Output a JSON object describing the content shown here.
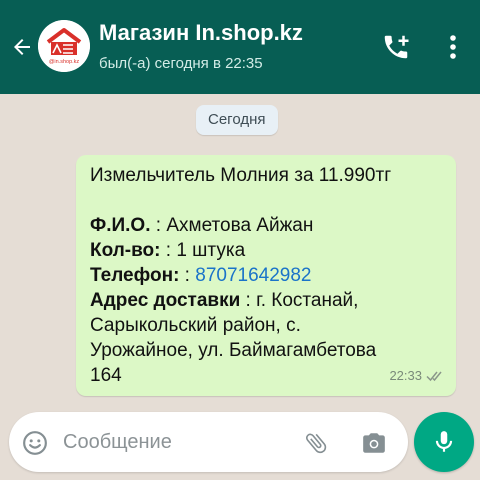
{
  "header": {
    "contact_name": "Магазин In.shop.kz",
    "last_seen": "был(-а) сегодня в 22:35",
    "avatar_text": "@in.shop.kz",
    "icons": {
      "back": "arrow-left-icon",
      "call": "add-call-icon",
      "menu": "more-vertical-icon"
    }
  },
  "chat": {
    "date_chip": "Сегодня",
    "message": {
      "product_line": "Измельчитель Молния за 11.990тг",
      "name_label": "Ф.И.О.",
      "name_value": " : Ахметова Айжан",
      "qty_label": "Кол-во:",
      "qty_value": " : 1 штука",
      "phone_label": "Телефон:",
      "phone_sep": " : ",
      "phone_value": "87071642982",
      "address_label": "Адрес доставки",
      "address_line1": " : г. Костанай,",
      "address_line2": "Сарыкольский район, с.",
      "address_line3": "Урожайное, ул. Баймагамбетова",
      "address_line4": "164",
      "time": "22:33",
      "status": "delivered"
    }
  },
  "composer": {
    "placeholder": "Сообщение",
    "icons": {
      "emoji": "emoji-icon",
      "attach": "paperclip-icon",
      "camera": "camera-icon",
      "mic": "microphone-icon"
    }
  },
  "colors": {
    "header_bg": "#075e54",
    "chat_bg": "#e5ddd5",
    "bubble_bg": "#dcf8c6",
    "accent": "#00a884",
    "link": "#1a73c9"
  }
}
